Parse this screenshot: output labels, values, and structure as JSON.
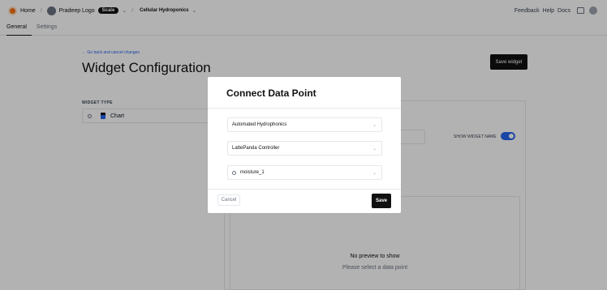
{
  "topbar": {
    "home": "Home",
    "org": "Pradeep Logo",
    "plan_badge": "Scale",
    "project": "Cellular Hydroponics",
    "links": [
      "Feedback",
      "Help",
      "Docs"
    ]
  },
  "tabs": [
    "General",
    "Settings"
  ],
  "header": {
    "back_link": "← Go back and cancel changes",
    "title": "Widget Configuration",
    "save_widget": "Save widget"
  },
  "widget_type": {
    "label": "WIDGET TYPE",
    "value": "Chart"
  },
  "right_panel": {
    "show_widget_name": "SHOW WIDGET NAME",
    "show_widget_name_on": true,
    "no_preview": "No preview to show",
    "select_data_point": "Please select a data point"
  },
  "modal": {
    "title": "Connect Data Point",
    "selects": [
      "Automated Hydrophonics",
      "LattePanda Controller",
      "moisture_1"
    ],
    "cancel": "Cancel",
    "save": "Save"
  },
  "colors": {
    "accent": "#2563eb",
    "primary_button": "#111111",
    "logo": "#f97316"
  }
}
